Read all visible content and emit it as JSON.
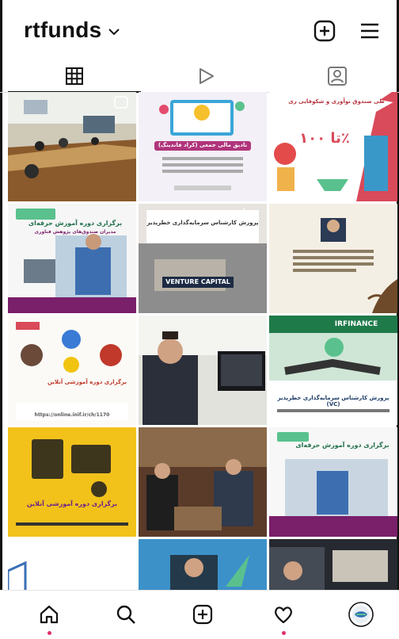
{
  "header": {
    "username": "rtfunds",
    "chevron_icon": "chevron-down-icon",
    "new_post_icon": "plus-square-icon",
    "menu_icon": "hamburger-menu-icon"
  },
  "tabs": [
    {
      "name": "grid",
      "icon": "grid-icon",
      "active": true
    },
    {
      "name": "reels",
      "icon": "play-icon",
      "active": false
    },
    {
      "name": "tagged",
      "icon": "tagged-person-icon",
      "active": false
    }
  ],
  "posts": [
    {
      "id": "post-1",
      "kind": "photo",
      "caption": ""
    },
    {
      "id": "post-2",
      "kind": "graphic",
      "caption": "نادیق مالی جمعی (کراد فاندینگ)"
    },
    {
      "id": "post-3",
      "kind": "graphic",
      "caption": "تا ۱۰۰٪",
      "subcaption": "طی صندوق نوآوری و شکوفایی ری"
    },
    {
      "id": "post-4",
      "kind": "graphic",
      "caption": "برگزاری دوره آموزش حرفه‌ای",
      "subcaption": "مدیران صندوق‌های پژوهش فناوری"
    },
    {
      "id": "post-5",
      "kind": "graphic",
      "caption": "VENTURE CAPITAL",
      "subcaption": "پرورش کارشناس سرمایه‌گذاری خطرپذیر"
    },
    {
      "id": "post-6",
      "kind": "graphic",
      "caption": ""
    },
    {
      "id": "post-7",
      "kind": "graphic",
      "caption": "برگزاری دوره آموزشی آنلاین",
      "subcaption": "https://online.inif.ir/ch/1170"
    },
    {
      "id": "post-8",
      "kind": "photo",
      "caption": ""
    },
    {
      "id": "post-9",
      "kind": "graphic",
      "caption": "IRFINANCE",
      "subcaption": "پرورش کارشناس سرمایه‌گذاری خطرپذیر (VC)"
    },
    {
      "id": "post-10",
      "kind": "graphic",
      "caption": "برگزاری دوره آموزشی آنلاین"
    },
    {
      "id": "post-11",
      "kind": "photo",
      "caption": ""
    },
    {
      "id": "post-12",
      "kind": "graphic",
      "caption": "برگزاری دوره آموزش حرفه‌ای"
    },
    {
      "id": "post-13",
      "kind": "graphic",
      "caption": ""
    },
    {
      "id": "post-14",
      "kind": "photo",
      "caption": ""
    },
    {
      "id": "post-15",
      "kind": "photo",
      "caption": ""
    }
  ],
  "navbar": [
    {
      "name": "home",
      "icon": "home-icon",
      "dot": true
    },
    {
      "name": "search",
      "icon": "search-icon",
      "dot": false
    },
    {
      "name": "create",
      "icon": "plus-square-icon",
      "dot": false
    },
    {
      "name": "activity",
      "icon": "heart-icon",
      "dot": true
    },
    {
      "name": "profile",
      "icon": "avatar-icon",
      "dot": false
    }
  ],
  "colors": {
    "accent_dot": "#e1306c",
    "brand_green": "#2e8b57",
    "brand_purple": "#5b2a86"
  }
}
